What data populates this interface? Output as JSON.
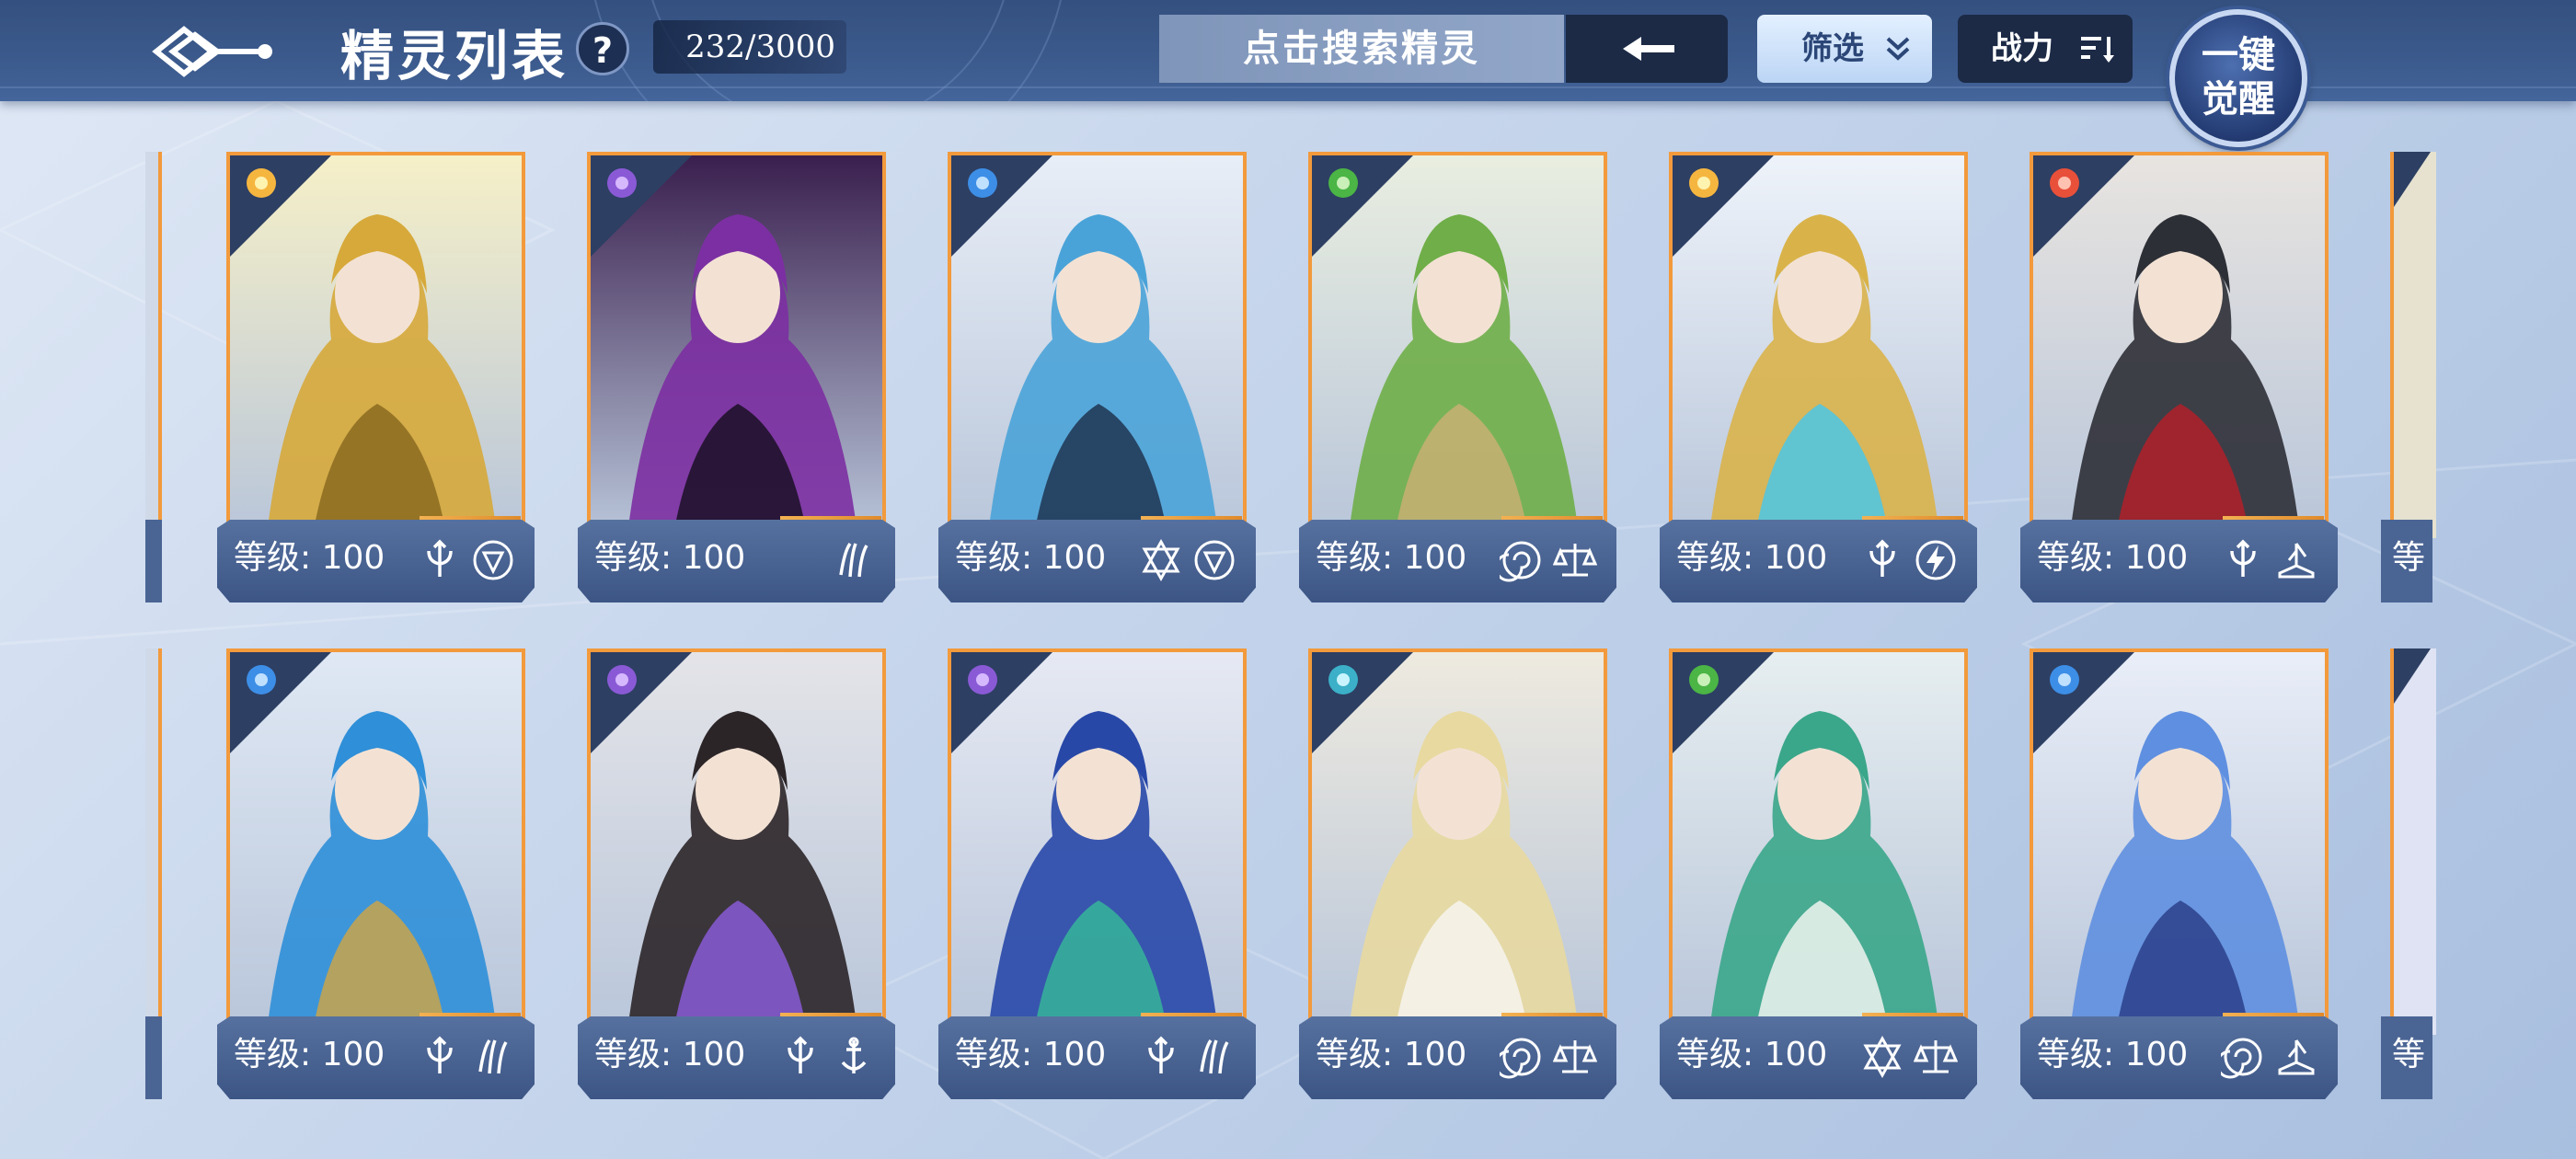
{
  "header": {
    "title": "精灵列表",
    "help": "?",
    "count": "232/3000",
    "search_placeholder": "点击搜索精灵",
    "filter_label": "筛选",
    "power_label": "战力",
    "awaken_line1": "一键",
    "awaken_line2": "觉醒"
  },
  "colors": {
    "topbar": "#3d5c8f",
    "card_border": "#f29a3c",
    "footer": "#4a6494"
  },
  "cards": [
    {
      "level": "等级: 100",
      "element": "light",
      "skills": [
        "trident-icon",
        "shield-icon"
      ],
      "art": "golden-dragon"
    },
    {
      "level": "等级: 100",
      "element": "dark",
      "skills": [
        "claw-icon"
      ],
      "art": "purple-crystal-beast"
    },
    {
      "level": "等级: 100",
      "element": "water",
      "skills": [
        "hexagram-icon",
        "shield-icon"
      ],
      "art": "blue-haired-knight"
    },
    {
      "level": "等级: 100",
      "element": "grass",
      "skills": [
        "spiral-icon",
        "scale-icon"
      ],
      "art": "green-goddess"
    },
    {
      "level": "等级: 100",
      "element": "light",
      "skills": [
        "trident-icon",
        "lightning-icon"
      ],
      "art": "white-mecha-dragon"
    },
    {
      "level": "等级: 100",
      "element": "fire",
      "skills": [
        "trident-icon",
        "book-icon"
      ],
      "art": "dark-armored-demon"
    },
    {
      "level": "等级: 100",
      "element": "water",
      "skills": [
        "trident-icon",
        "claw-icon"
      ],
      "art": "blue-haired-archer"
    },
    {
      "level": "等级: 100",
      "element": "dark",
      "skills": [
        "trident-icon",
        "anchor-icon"
      ],
      "art": "masked-dark-warrior"
    },
    {
      "level": "等级: 100",
      "element": "dark",
      "skills": [
        "trident-icon",
        "claw-icon"
      ],
      "art": "horned-blue-general"
    },
    {
      "level": "等级: 100",
      "element": "ice",
      "skills": [
        "spiral-icon",
        "scale-icon"
      ],
      "art": "blonde-elf-maiden"
    },
    {
      "level": "等级: 100",
      "element": "grass",
      "skills": [
        "hexagram-icon",
        "scale-icon"
      ],
      "art": "jade-robed-scholar"
    },
    {
      "level": "等级: 100",
      "element": "water",
      "skills": [
        "spiral-icon",
        "book-icon"
      ],
      "art": "blue-haired-dragon-girl"
    }
  ],
  "partial_level": "等"
}
